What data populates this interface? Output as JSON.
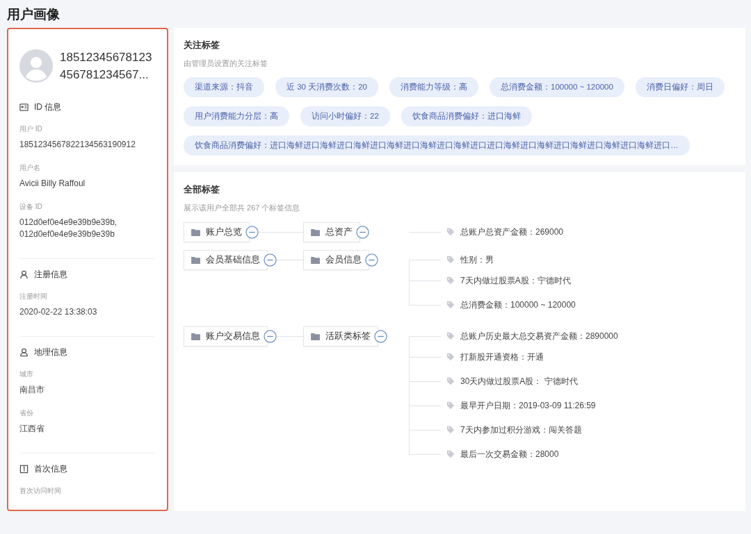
{
  "page_title": "用户画像",
  "profile": {
    "name": "18512345678123456781234567...",
    "highlighted": true,
    "sections": [
      {
        "kind": "id",
        "title": "ID 信息",
        "fields": [
          {
            "label": "用户 ID",
            "value": "1851234567822134563190912"
          },
          {
            "label": "用户名",
            "value": "Avicii Billy Raffoul"
          },
          {
            "label": "设备 ID",
            "value": "012d0ef0e4e9e39b9e39b, 012d0ef0e4e9e39b9e39b"
          }
        ]
      },
      {
        "kind": "user",
        "title": "注册信息",
        "fields": [
          {
            "label": "注册时间",
            "value": "2020-02-22 13:38:03"
          }
        ]
      },
      {
        "kind": "geo",
        "title": "地理信息",
        "fields": [
          {
            "label": "城市",
            "value": "南昌市"
          },
          {
            "label": "省份",
            "value": "江西省"
          }
        ]
      },
      {
        "kind": "first",
        "title": "首次信息",
        "fields": [
          {
            "label": "首次访问时间"
          }
        ]
      }
    ]
  },
  "focus_tags": {
    "title": "关注标签",
    "subtitle": "由管理员设置的关注标签",
    "tags": [
      "渠道来源：抖音",
      "近 30 天消费次数：20",
      "消费能力等级：高",
      "总消费金额：100000 ~ 120000",
      "消费日偏好：周日",
      "用户消费能力分层：高",
      "访问小时偏好：22",
      "饮食商品消费偏好：进口海鲜",
      "饮食商品消费偏好：进口海鲜进口海鲜进口海鲜进口海鲜进口海鲜进口海鲜进口进口海鲜进口海鲜进口海鲜进口海鲜进口海鲜进口…"
    ]
  },
  "all_tags": {
    "title": "全部标签",
    "subtitle": "展示该用户全部共 267 个标签信息",
    "tree": [
      {
        "label": "账户总览",
        "expanded": true,
        "children": [
          {
            "label": "总资产",
            "expanded": true,
            "children": [
              {
                "label": "总账户总资产金额：269000"
              }
            ]
          }
        ]
      },
      {
        "label": "会员基础信息",
        "expanded": true,
        "children": [
          {
            "label": "会员信息",
            "expanded": true,
            "children": [
              {
                "label": "性别：男"
              },
              {
                "label": "7天内做过股票A股：宁德时代"
              },
              {
                "label": "总消费金额：100000 ~ 120000"
              }
            ]
          }
        ]
      },
      {
        "label": "账户交易信息",
        "expanded": true,
        "children": [
          {
            "label": "活跃类标签",
            "expanded": true,
            "children": [
              {
                "label": "总账户历史最大总交易资产金额：2890000"
              },
              {
                "label": "打新股开通资格：开通"
              },
              {
                "label": "30天内做过股票A股： 宁德时代"
              },
              {
                "label": "最早开户日期：2019-03-09 11:26:59"
              },
              {
                "label": "7天内参加过积分游戏：闯关答题"
              },
              {
                "label": "最后一次交易金额：28000"
              }
            ]
          }
        ]
      }
    ]
  }
}
